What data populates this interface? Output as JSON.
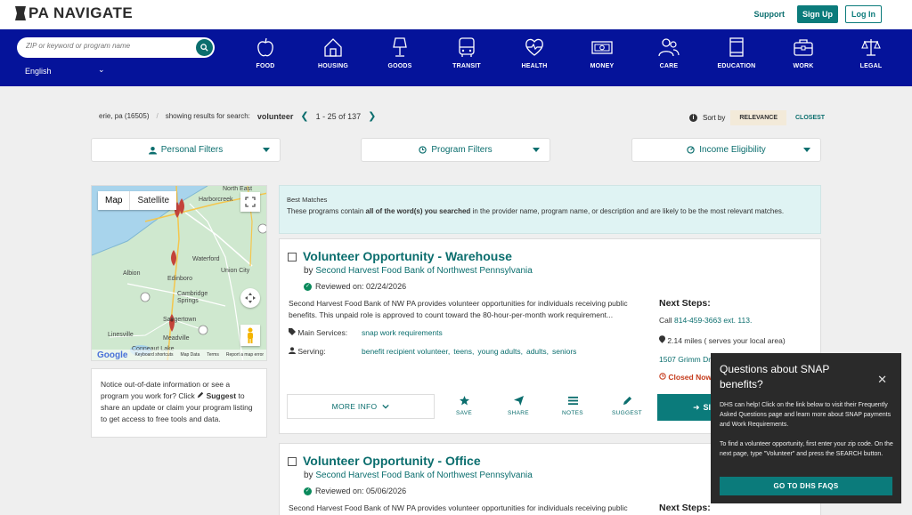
{
  "header": {
    "logo_text": "PA NAVIGATE",
    "support": "Support",
    "signup": "Sign Up",
    "login": "Log In"
  },
  "search": {
    "placeholder": "ZIP or keyword or program name",
    "language": "English"
  },
  "categories": [
    {
      "label": "FOOD",
      "icon": "apple-icon"
    },
    {
      "label": "HOUSING",
      "icon": "house-icon"
    },
    {
      "label": "GOODS",
      "icon": "lamp-icon"
    },
    {
      "label": "TRANSIT",
      "icon": "bus-icon"
    },
    {
      "label": "HEALTH",
      "icon": "heart-pulse-icon"
    },
    {
      "label": "MONEY",
      "icon": "money-icon"
    },
    {
      "label": "CARE",
      "icon": "people-icon"
    },
    {
      "label": "EDUCATION",
      "icon": "book-icon"
    },
    {
      "label": "WORK",
      "icon": "briefcase-icon"
    },
    {
      "label": "LEGAL",
      "icon": "scales-icon"
    }
  ],
  "results": {
    "location": "erie, pa (16505)",
    "showing_label": "showing results for search:",
    "keyword": "volunteer",
    "range": "1 - 25 of 137",
    "sort_label": "Sort by",
    "sort_active": "RELEVANCE",
    "sort_other": "CLOSEST"
  },
  "filters": {
    "personal": "Personal Filters",
    "program": "Program Filters",
    "income": "Income Eligibility"
  },
  "map": {
    "toggle_map": "Map",
    "toggle_satellite": "Satellite",
    "labels": [
      "North East",
      "Harborcreek",
      "Waterford",
      "Union City",
      "Albion",
      "Edinboro",
      "Cambridge Springs",
      "Saegertown",
      "Meadville",
      "Linesville",
      "Conneaut Lake"
    ],
    "footer": [
      "Keyboard shortcuts",
      "Map Data",
      "Terms",
      "Report a map error"
    ],
    "google": "Google"
  },
  "notice": {
    "text_1": "Notice out-of-date information or see a program you work for? Click",
    "suggest": "Suggest",
    "text_2": "to share an update or claim your program listing to get access to free tools and data."
  },
  "best_matches": {
    "heading": "Best Matches",
    "text_1": "These programs contain",
    "bold": "all of the word(s) you searched",
    "text_2": "in the provider name, program name, or description and are likely to be the most relevant matches."
  },
  "cards": [
    {
      "title": "Volunteer Opportunity - Warehouse",
      "by": "by",
      "provider": "Second Harvest Food Bank of Northwest Pennsylvania",
      "reviewed": "Reviewed on: 02/24/2026",
      "description": "Second Harvest Food Bank of NW PA provides volunteer opportunities for individuals receiving public benefits. This unpaid role is approved to count toward the 80-hour-per-month work requirement...",
      "main_services_label": "Main Services:",
      "main_services": "snap work requirements",
      "serving_label": "Serving:",
      "serving": [
        "benefit recipient volunteer,",
        "teens,",
        "young adults,",
        "adults,",
        "seniors"
      ],
      "next_steps": "Next Steps:",
      "call_label": "Call",
      "phone": "814-459-3663 ext. 113.",
      "miles": "2.14 miles ( serves your local area)",
      "address": "1507 Grimm Drive, Erie, PA 16501",
      "closed": "Closed Now",
      "more_info": "MORE INFO",
      "actions": [
        "SAVE",
        "SHARE",
        "NOTES",
        "SUGGEST"
      ],
      "signup": "SIGN UP"
    },
    {
      "title": "Volunteer Opportunity - Office",
      "by": "by",
      "provider": "Second Harvest Food Bank of Northwest Pennsylvania",
      "reviewed": "Reviewed on: 05/06/2026",
      "description": "Second Harvest Food Bank of NW PA provides volunteer opportunities for individuals receiving public",
      "next_steps": "Next Steps:"
    }
  ],
  "popup": {
    "title": "Questions about SNAP benefits?",
    "p1": "DHS can help! Click on the link below to visit their Frequently Asked Questions page and learn more about SNAP payments and Work Requirements.",
    "p2": "To find a volunteer opportunity, first enter your zip code. On the next page, type \"Volunteer\" and press the SEARCH button.",
    "button": "GO TO DHS FAQS"
  },
  "colors": {
    "nav_blue": "#05139a",
    "teal": "#0b7b7b",
    "closed_red": "#c53b1c"
  }
}
